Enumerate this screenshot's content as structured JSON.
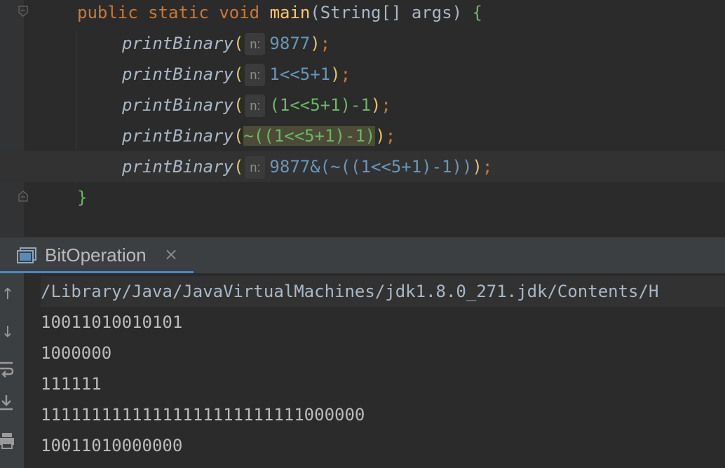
{
  "editor": {
    "main_sig": {
      "kw1": "public",
      "kw2": "static",
      "kw3": "void",
      "name": "main",
      "params": "(String[] args) ",
      "open": "{"
    },
    "hint_label": "n:",
    "lines": [
      {
        "fn": "printBinary",
        "arg": "9877"
      },
      {
        "fn": "printBinary",
        "arg": "1<<5+1"
      },
      {
        "fn": "printBinary",
        "arg": "(1<<5+1)-1"
      },
      {
        "fn": "printBinary",
        "arg": "~((1<<5+1)-1)"
      },
      {
        "fn": "printBinary",
        "arg": "9877&(~((1<<5+1)-1))"
      }
    ],
    "close": "}"
  },
  "run_tab": {
    "label": "BitOperation",
    "close_label": "×"
  },
  "console": {
    "command": "/Library/Java/JavaVirtualMachines/jdk1.8.0_271.jdk/Contents/H",
    "output": [
      "10011010010101",
      "1000000",
      "111111",
      "11111111111111111111111111000000",
      "10011010000000"
    ]
  },
  "side_icons": [
    "up-arrow-icon",
    "down-arrow-icon",
    "soft-wrap-icon",
    "scroll-to-end-icon",
    "print-icon"
  ]
}
